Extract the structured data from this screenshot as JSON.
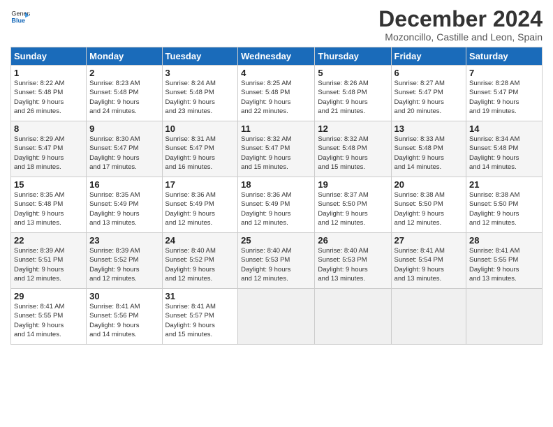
{
  "header": {
    "logo_line1": "General",
    "logo_line2": "Blue",
    "title": "December 2024",
    "subtitle": "Mozoncillo, Castille and Leon, Spain"
  },
  "calendar": {
    "weekdays": [
      "Sunday",
      "Monday",
      "Tuesday",
      "Wednesday",
      "Thursday",
      "Friday",
      "Saturday"
    ],
    "weeks": [
      [
        {
          "day": "",
          "info": ""
        },
        {
          "day": "2",
          "info": "Sunrise: 8:23 AM\nSunset: 5:48 PM\nDaylight: 9 hours\nand 24 minutes."
        },
        {
          "day": "3",
          "info": "Sunrise: 8:24 AM\nSunset: 5:48 PM\nDaylight: 9 hours\nand 23 minutes."
        },
        {
          "day": "4",
          "info": "Sunrise: 8:25 AM\nSunset: 5:48 PM\nDaylight: 9 hours\nand 22 minutes."
        },
        {
          "day": "5",
          "info": "Sunrise: 8:26 AM\nSunset: 5:48 PM\nDaylight: 9 hours\nand 21 minutes."
        },
        {
          "day": "6",
          "info": "Sunrise: 8:27 AM\nSunset: 5:47 PM\nDaylight: 9 hours\nand 20 minutes."
        },
        {
          "day": "7",
          "info": "Sunrise: 8:28 AM\nSunset: 5:47 PM\nDaylight: 9 hours\nand 19 minutes."
        }
      ],
      [
        {
          "day": "1",
          "info": "Sunrise: 8:22 AM\nSunset: 5:48 PM\nDaylight: 9 hours\nand 26 minutes."
        },
        {
          "day": "9",
          "info": "Sunrise: 8:30 AM\nSunset: 5:47 PM\nDaylight: 9 hours\nand 17 minutes."
        },
        {
          "day": "10",
          "info": "Sunrise: 8:31 AM\nSunset: 5:47 PM\nDaylight: 9 hours\nand 16 minutes."
        },
        {
          "day": "11",
          "info": "Sunrise: 8:32 AM\nSunset: 5:47 PM\nDaylight: 9 hours\nand 15 minutes."
        },
        {
          "day": "12",
          "info": "Sunrise: 8:32 AM\nSunset: 5:48 PM\nDaylight: 9 hours\nand 15 minutes."
        },
        {
          "day": "13",
          "info": "Sunrise: 8:33 AM\nSunset: 5:48 PM\nDaylight: 9 hours\nand 14 minutes."
        },
        {
          "day": "14",
          "info": "Sunrise: 8:34 AM\nSunset: 5:48 PM\nDaylight: 9 hours\nand 14 minutes."
        }
      ],
      [
        {
          "day": "8",
          "info": "Sunrise: 8:29 AM\nSunset: 5:47 PM\nDaylight: 9 hours\nand 18 minutes."
        },
        {
          "day": "16",
          "info": "Sunrise: 8:35 AM\nSunset: 5:49 PM\nDaylight: 9 hours\nand 13 minutes."
        },
        {
          "day": "17",
          "info": "Sunrise: 8:36 AM\nSunset: 5:49 PM\nDaylight: 9 hours\nand 12 minutes."
        },
        {
          "day": "18",
          "info": "Sunrise: 8:36 AM\nSunset: 5:49 PM\nDaylight: 9 hours\nand 12 minutes."
        },
        {
          "day": "19",
          "info": "Sunrise: 8:37 AM\nSunset: 5:50 PM\nDaylight: 9 hours\nand 12 minutes."
        },
        {
          "day": "20",
          "info": "Sunrise: 8:38 AM\nSunset: 5:50 PM\nDaylight: 9 hours\nand 12 minutes."
        },
        {
          "day": "21",
          "info": "Sunrise: 8:38 AM\nSunset: 5:50 PM\nDaylight: 9 hours\nand 12 minutes."
        }
      ],
      [
        {
          "day": "15",
          "info": "Sunrise: 8:35 AM\nSunset: 5:48 PM\nDaylight: 9 hours\nand 13 minutes."
        },
        {
          "day": "23",
          "info": "Sunrise: 8:39 AM\nSunset: 5:52 PM\nDaylight: 9 hours\nand 12 minutes."
        },
        {
          "day": "24",
          "info": "Sunrise: 8:40 AM\nSunset: 5:52 PM\nDaylight: 9 hours\nand 12 minutes."
        },
        {
          "day": "25",
          "info": "Sunrise: 8:40 AM\nSunset: 5:53 PM\nDaylight: 9 hours\nand 12 minutes."
        },
        {
          "day": "26",
          "info": "Sunrise: 8:40 AM\nSunset: 5:53 PM\nDaylight: 9 hours\nand 13 minutes."
        },
        {
          "day": "27",
          "info": "Sunrise: 8:41 AM\nSunset: 5:54 PM\nDaylight: 9 hours\nand 13 minutes."
        },
        {
          "day": "28",
          "info": "Sunrise: 8:41 AM\nSunset: 5:55 PM\nDaylight: 9 hours\nand 13 minutes."
        }
      ],
      [
        {
          "day": "22",
          "info": "Sunrise: 8:39 AM\nSunset: 5:51 PM\nDaylight: 9 hours\nand 12 minutes."
        },
        {
          "day": "30",
          "info": "Sunrise: 8:41 AM\nSunset: 5:56 PM\nDaylight: 9 hours\nand 14 minutes."
        },
        {
          "day": "31",
          "info": "Sunrise: 8:41 AM\nSunset: 5:57 PM\nDaylight: 9 hours\nand 15 minutes."
        },
        {
          "day": "",
          "info": ""
        },
        {
          "day": "",
          "info": ""
        },
        {
          "day": "",
          "info": ""
        },
        {
          "day": "",
          "info": ""
        }
      ],
      [
        {
          "day": "29",
          "info": "Sunrise: 8:41 AM\nSunset: 5:55 PM\nDaylight: 9 hours\nand 14 minutes."
        },
        {
          "day": "",
          "info": ""
        },
        {
          "day": "",
          "info": ""
        },
        {
          "day": "",
          "info": ""
        },
        {
          "day": "",
          "info": ""
        },
        {
          "day": "",
          "info": ""
        },
        {
          "day": "",
          "info": ""
        }
      ]
    ]
  }
}
